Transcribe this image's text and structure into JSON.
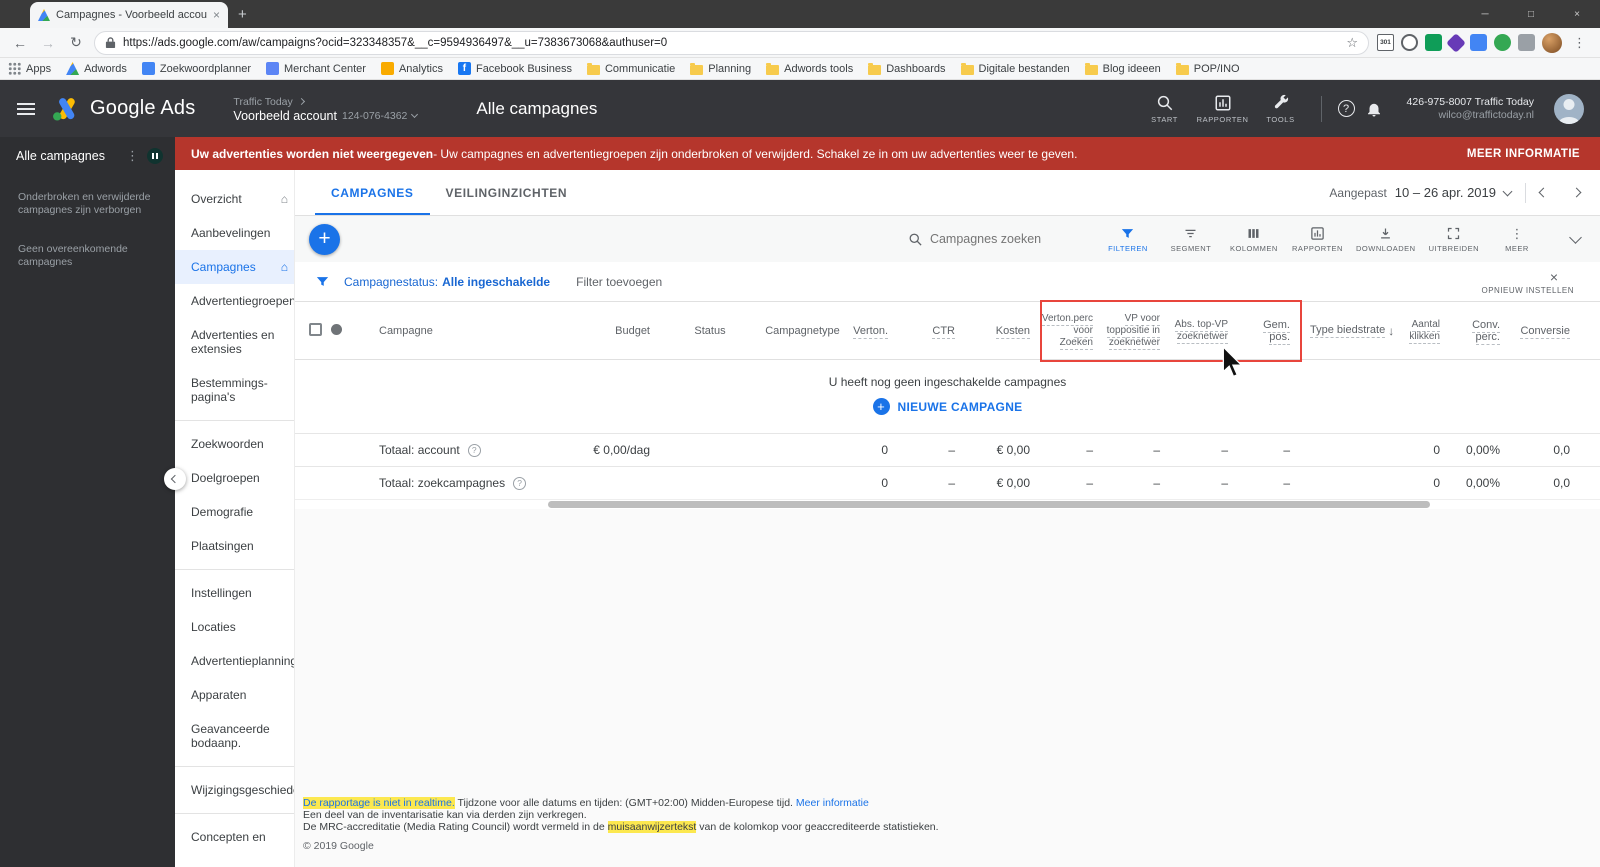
{
  "colors": {
    "accent_blue": "#1a73e8",
    "banner_red": "#b5362c",
    "column_highlight_red": "#e8453c",
    "header_dark": "#35363a",
    "rail_dark": "#2e2f32",
    "find_highlight_yellow": "#fce84f"
  },
  "icons": {
    "close": "×",
    "more_vertical": "⋮",
    "help": "?",
    "home": "⌂",
    "plus": "+",
    "minimize": "─",
    "maximize": "□",
    "back": "←",
    "forward": "→",
    "refresh": "↻",
    "star": "☆",
    "sort_down": "↓"
  },
  "browser": {
    "tab_title": "Campagnes - Voorbeeld account",
    "url": "https://ads.google.com/aw/campaigns?ocid=323348357&__c=9594936497&__u=7383673068&authuser=0",
    "extension_badge": "301",
    "bookmarks": [
      {
        "label": "Apps"
      },
      {
        "label": "Adwords"
      },
      {
        "label": "Zoekwoordplanner"
      },
      {
        "label": "Merchant Center"
      },
      {
        "label": "Analytics"
      },
      {
        "label": "Facebook Business"
      },
      {
        "label": "Communicatie"
      },
      {
        "label": "Planning"
      },
      {
        "label": "Adwords tools"
      },
      {
        "label": "Dashboards"
      },
      {
        "label": "Digitale bestanden"
      },
      {
        "label": "Blog ideeen"
      },
      {
        "label": "POP/INO"
      }
    ]
  },
  "app_header": {
    "brand": "Google Ads",
    "breadcrumb": "Traffic Today",
    "account_name": "Voorbeeld account",
    "account_id": "124-076-4362",
    "page_title": "Alle campagnes",
    "nav_search": "START",
    "nav_reports": "RAPPORTEN",
    "nav_tools": "TOOLS",
    "account_line1": "426-975-8007 Traffic Today",
    "account_line2": "wilco@traffictoday.nl"
  },
  "alert": {
    "bold": "Uw advertenties worden niet weergegeven",
    "rest": " - Uw campagnes en advertentiegroepen zijn onderbroken of verwijderd. Schakel ze in om uw advertenties weer te geven.",
    "action": "MEER INFORMATIE"
  },
  "rail": {
    "title": "Alle campagnes",
    "note_hidden": "Onderbroken en verwijderde campagnes zijn verborgen",
    "note_empty": "Geen overeenkomende campagnes"
  },
  "sidebar": {
    "items": [
      {
        "label": "Overzicht"
      },
      {
        "label": "Aanbevelingen"
      },
      {
        "label": "Campagnes"
      },
      {
        "label": "Advertentiegroepen"
      },
      {
        "label": "Advertenties en extensies"
      },
      {
        "label": "Bestemmings-pagina's"
      },
      {
        "label": "Zoekwoorden"
      },
      {
        "label": "Doelgroepen"
      },
      {
        "label": "Demografie"
      },
      {
        "label": "Plaatsingen"
      },
      {
        "label": "Instellingen"
      },
      {
        "label": "Locaties"
      },
      {
        "label": "Advertentieplanning"
      },
      {
        "label": "Apparaten"
      },
      {
        "label": "Geavanceerde bodaanp."
      },
      {
        "label": "Wijzigingsgeschieden"
      },
      {
        "label": "Concepten en"
      }
    ]
  },
  "tabs": {
    "campaigns": "CAMPAGNES",
    "auction": "VEILINGINZICHTEN"
  },
  "date_range": {
    "label": "Aangepast",
    "value": "10 – 26 apr. 2019"
  },
  "toolbar": {
    "search_placeholder": "Campagnes zoeken",
    "filter": "FILTEREN",
    "segment": "SEGMENT",
    "columns": "KOLOMMEN",
    "reports": "RAPPORTEN",
    "download": "DOWNLOADEN",
    "expand": "UITBREIDEN",
    "more": "MEER"
  },
  "filter_bar": {
    "label": "Campagnestatus:",
    "value": "Alle ingeschakelde",
    "add": "Filter toevoegen",
    "reset": "OPNIEUW INSTELLEN"
  },
  "table": {
    "columns": {
      "campaign": "Campagne",
      "budget": "Budget",
      "status": "Status",
      "type": "Campagnetype",
      "impr": "Verton.",
      "ctr": "CTR",
      "cost": "Kosten",
      "impr_share": "Verton.perc voor Zoeken",
      "top_is": "VP voor toppositie in zoeknetwer",
      "abs_top_is": "Abs. top-VP zoeknetwer",
      "avg_pos": "Gem. pos.",
      "bid_strategy": "Type biedstrate",
      "clicks": "Aantal klikken",
      "conv_rate": "Conv. perc.",
      "conversions": "Conversie"
    },
    "empty_text": "U heeft nog geen ingeschakelde campagnes",
    "new_campaign": "NIEUWE CAMPAGNE",
    "rows": [
      {
        "label": "Totaal: account",
        "budget": "€ 0,00/dag",
        "status": "",
        "type": "",
        "impr": "0",
        "ctr": "–",
        "cost": "€ 0,00",
        "impr_share": "–",
        "top_is": "–",
        "abs_top_is": "–",
        "avg_pos": "–",
        "bid_strategy": "",
        "clicks": "0",
        "conv_rate": "0,00%",
        "conversions": "0,0"
      },
      {
        "label": "Totaal: zoekcampagnes",
        "budget": "",
        "status": "",
        "type": "",
        "impr": "0",
        "ctr": "–",
        "cost": "€ 0,00",
        "impr_share": "–",
        "top_is": "–",
        "abs_top_is": "–",
        "avg_pos": "–",
        "bid_strategy": "",
        "clicks": "0",
        "conv_rate": "0,00%",
        "conversions": "0,0"
      }
    ]
  },
  "footer": {
    "link1": "De rapportage is niet in realtime.",
    "middle": "Tijdzone voor alle datums en tijden: (GMT+02:00) Midden-Europese tijd.",
    "link2": "Meer informatie",
    "line2": "Een deel van de inventarisatie kan via derden zijn verkregen.",
    "line3_pre": "De MRC-accreditatie (Media Rating Council) wordt vermeld in de ",
    "line3_hl": "muisaanwijzertekst",
    "line3_post": " van de kolomkop voor geaccrediteerde statistieken.",
    "copyright": "© 2019 Google"
  }
}
